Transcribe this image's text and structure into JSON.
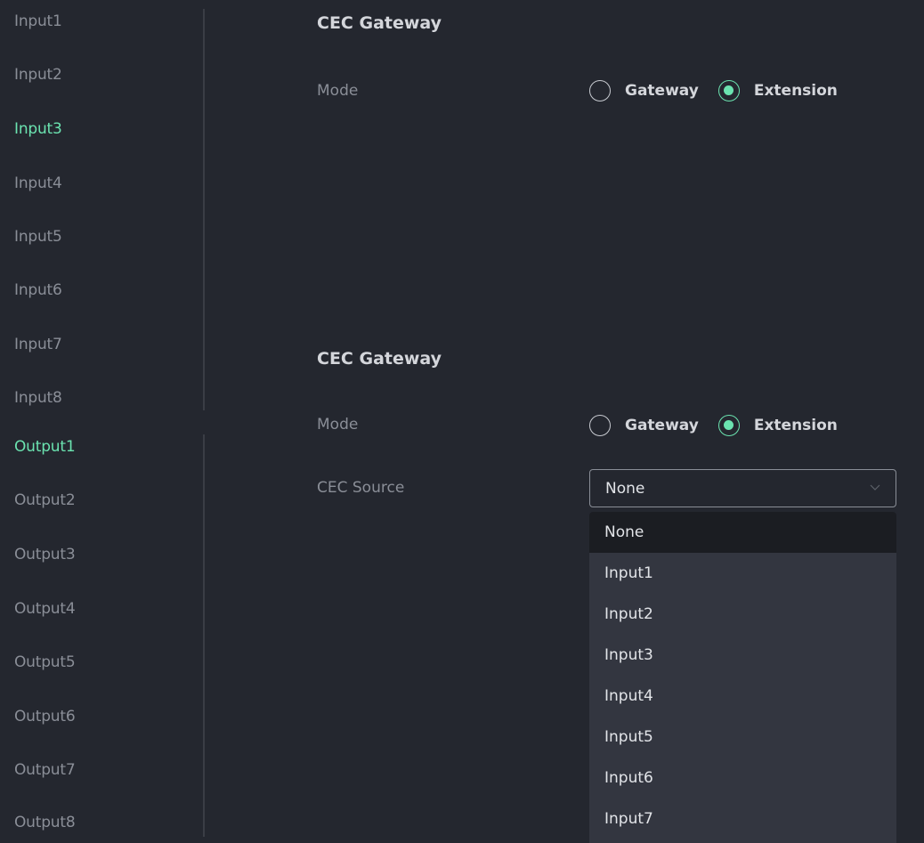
{
  "sidebar": {
    "items": [
      {
        "label": "Input1",
        "active": false
      },
      {
        "label": "Input2",
        "active": false
      },
      {
        "label": "Input3",
        "active": true
      },
      {
        "label": "Input4",
        "active": false
      },
      {
        "label": "Input5",
        "active": false
      },
      {
        "label": "Input6",
        "active": false
      },
      {
        "label": "Input7",
        "active": false
      },
      {
        "label": "Input8",
        "active": false
      },
      {
        "label": "Output1",
        "active": true
      },
      {
        "label": "Output2",
        "active": false
      },
      {
        "label": "Output3",
        "active": false
      },
      {
        "label": "Output4",
        "active": false
      },
      {
        "label": "Output5",
        "active": false
      },
      {
        "label": "Output6",
        "active": false
      },
      {
        "label": "Output7",
        "active": false
      },
      {
        "label": "Output8",
        "active": false
      }
    ]
  },
  "input_section": {
    "title": "CEC Gateway",
    "mode_label": "Mode",
    "mode_options": [
      {
        "label": "Gateway",
        "checked": false
      },
      {
        "label": "Extension",
        "checked": true
      }
    ]
  },
  "output_section": {
    "title": "CEC Gateway",
    "mode_label": "Mode",
    "mode_options": [
      {
        "label": "Gateway",
        "checked": false
      },
      {
        "label": "Extension",
        "checked": true
      }
    ],
    "source_label": "CEC Source",
    "source_value": "None",
    "source_options": [
      "None",
      "Input1",
      "Input2",
      "Input3",
      "Input4",
      "Input5",
      "Input6",
      "Input7"
    ],
    "selected_index": 0
  },
  "colors": {
    "background": "#24272f",
    "accent": "#6be3b0",
    "muted_text": "#8a8e97",
    "dropdown_bg": "#333640",
    "dropdown_selected_bg": "#1b1d22"
  },
  "icons": {
    "select_chevron": "chevron-down-icon",
    "radio_unchecked": "radio-unchecked-icon",
    "radio_checked": "radio-checked-icon"
  }
}
